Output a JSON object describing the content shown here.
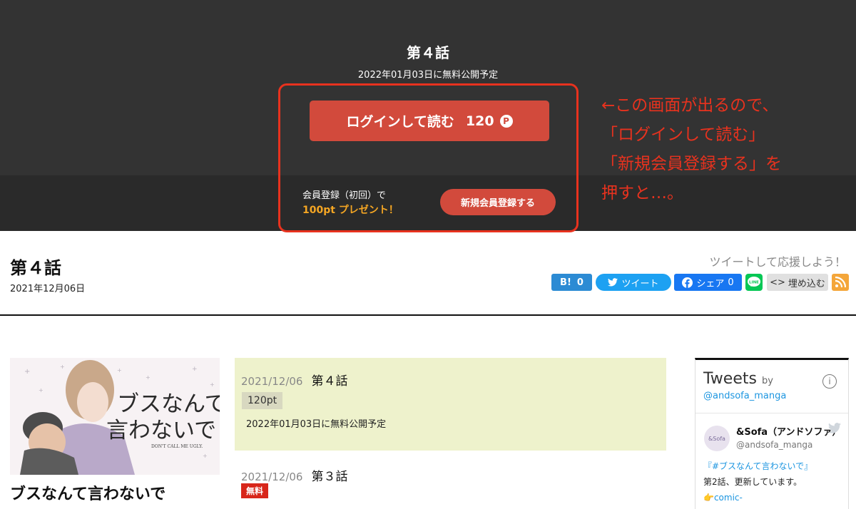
{
  "overlay": {
    "episode_title": "第４話",
    "release_note": "2022年01月03日に無料公開予定",
    "login_button": "ログインして読む",
    "login_points": "120",
    "point_icon": "P",
    "register_line1": "会員登録（初回）で",
    "register_line2": "100pt プレゼント！",
    "register_button": "新規会員登録する",
    "annotation": "←この画面が出るので、\n「ログインして読む」\n「新規会員登録する」を\n押すと…。",
    "accent_color": "#d24a3c",
    "annotation_color": "#e8321e"
  },
  "header": {
    "title": "第４話",
    "date": "2021年12月06日",
    "tweet_prompt": "ツイートして応援しよう！",
    "hatena_label": "B!",
    "hatena_count": "0",
    "tweet_label": "ツイート",
    "fb_label": "シェア",
    "fb_count": "0",
    "line_label": "LINE",
    "embed_label": "埋め込む",
    "embed_icon": "<>"
  },
  "series": {
    "title": "ブスなんて言わないで",
    "cover_title": "ブスなんて言わないで",
    "cover_subtitle": "DON'T CALL ME UGLY."
  },
  "episodes": [
    {
      "date": "2021/12/06",
      "title": "第４話",
      "badge": "120pt",
      "schedule": "2022年01月03日に無料公開予定"
    },
    {
      "date": "2021/12/06",
      "title": "第３話",
      "badge": "無料"
    }
  ],
  "twitter": {
    "heading": "Tweets",
    "by": "by",
    "handle": "@andsofa_manga",
    "info_icon": "i",
    "account_name": "&Sofa（アンドソファ）",
    "account_user": "@andsofa_manga",
    "avatar_text": "&Sofa",
    "line1": "『#ブスなんて言わないで』",
    "line2": "第2話、更新しています。",
    "line3": "👉comic-"
  }
}
